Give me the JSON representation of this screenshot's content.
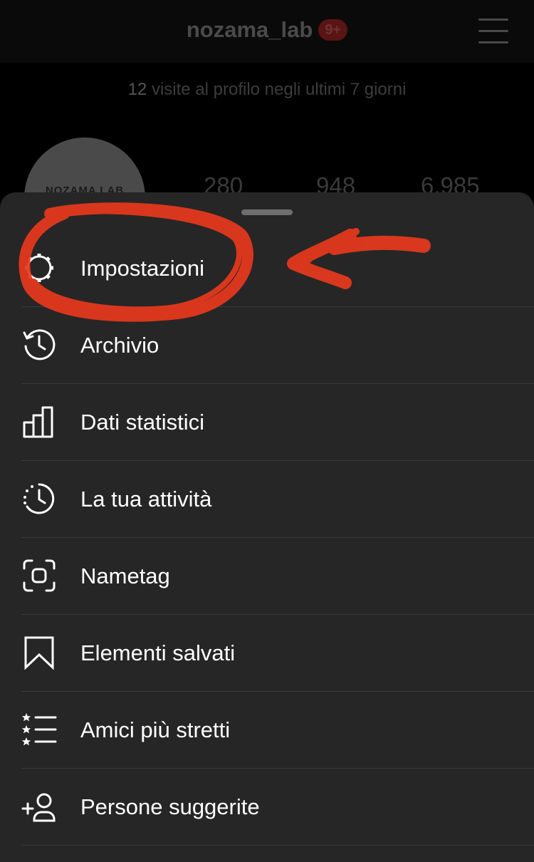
{
  "header": {
    "username": "nozama_lab",
    "notification_badge": "9+"
  },
  "profile": {
    "visits_count": "12",
    "visits_text": "visite al profilo negli ultimi 7 giorni",
    "avatar_text": "NOZAMA LAB",
    "stats": [
      "280",
      "948",
      "6.985"
    ]
  },
  "menu": {
    "items": [
      {
        "label": "Impostazioni",
        "icon": "settings-gear-icon"
      },
      {
        "label": "Archivio",
        "icon": "archive-clock-icon"
      },
      {
        "label": "Dati statistici",
        "icon": "bar-chart-icon"
      },
      {
        "label": "La tua attività",
        "icon": "activity-clock-icon"
      },
      {
        "label": "Nametag",
        "icon": "nametag-scan-icon"
      },
      {
        "label": "Elementi salvati",
        "icon": "bookmark-icon"
      },
      {
        "label": "Amici più stretti",
        "icon": "close-friends-list-icon"
      },
      {
        "label": "Persone suggerite",
        "icon": "add-person-icon"
      }
    ]
  },
  "colors": {
    "sheet_background": "#262626",
    "annotation_red": "#e8391d",
    "badge_red": "#5a1414"
  }
}
